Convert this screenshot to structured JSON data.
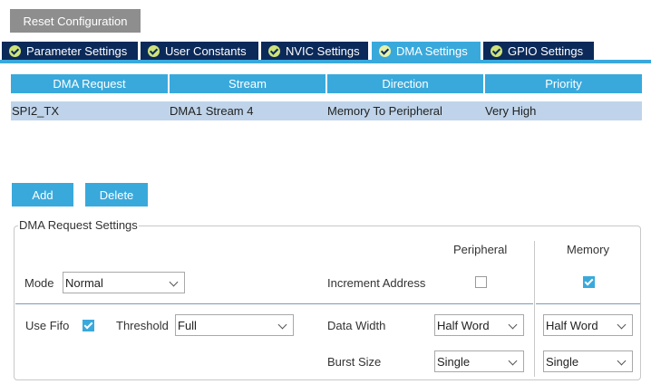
{
  "toolbar": {
    "reset_label": "Reset Configuration"
  },
  "tabs": [
    {
      "label": "Parameter Settings",
      "active": false
    },
    {
      "label": "User Constants",
      "active": false
    },
    {
      "label": "NVIC Settings",
      "active": false
    },
    {
      "label": "DMA Settings",
      "active": true
    },
    {
      "label": "GPIO Settings",
      "active": false
    }
  ],
  "table": {
    "columns": [
      "DMA Request",
      "Stream",
      "Direction",
      "Priority"
    ],
    "rows": [
      [
        "SPI2_TX",
        "DMA1 Stream 4",
        "Memory To Peripheral",
        "Very High"
      ]
    ]
  },
  "actions": {
    "add_label": "Add",
    "delete_label": "Delete"
  },
  "settings": {
    "title": "DMA Request Settings",
    "peripheral_header": "Peripheral",
    "memory_header": "Memory",
    "mode_label": "Mode",
    "mode_value": "Normal",
    "increment_label": "Increment Address",
    "increment_peripheral": false,
    "increment_memory": true,
    "fifo_label": "Use Fifo",
    "fifo_checked": true,
    "threshold_label": "Threshold",
    "threshold_value": "Full",
    "data_width_label": "Data Width",
    "data_width_peripheral": "Half Word",
    "data_width_memory": "Half Word",
    "burst_label": "Burst Size",
    "burst_peripheral": "Single",
    "burst_memory": "Single"
  },
  "colors": {
    "tab_bg": "#0b2a5a",
    "accent": "#39a9dc",
    "row_selected": "#bfd4ea",
    "reset_button": "#8e8e8e"
  }
}
